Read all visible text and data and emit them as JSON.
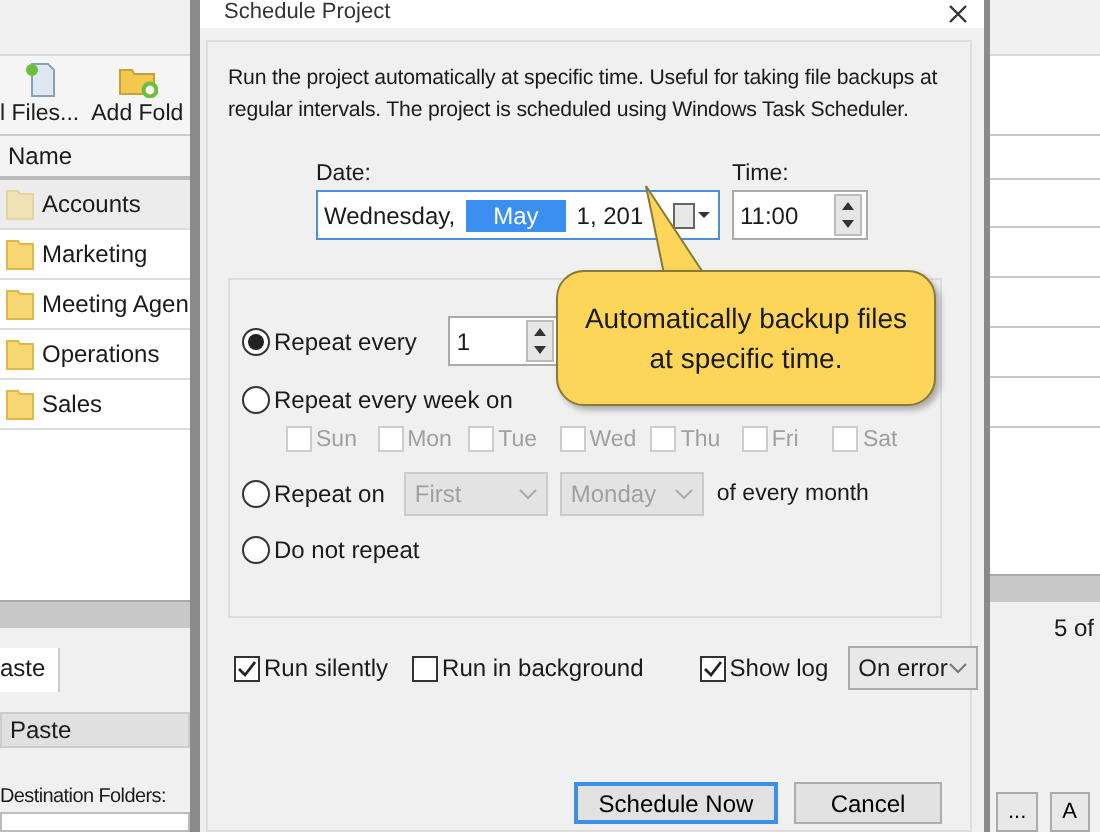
{
  "background_app": {
    "toolbar": [
      {
        "label": "l Files..."
      },
      {
        "label": "Add Fold"
      }
    ],
    "table": {
      "columns": [
        "Name"
      ],
      "rows": [
        {
          "name": "Accounts",
          "selected": true
        },
        {
          "name": "Marketing",
          "selected": false
        },
        {
          "name": "Meeting Agen",
          "selected": false
        },
        {
          "name": "Operations",
          "selected": false
        },
        {
          "name": "Sales",
          "selected": false
        }
      ]
    },
    "tab": {
      "label": "aste"
    },
    "paste_field": {
      "value": "Paste"
    },
    "destination_label": "Destination Folders:",
    "count": "5 of",
    "buttons": [
      "...",
      "A"
    ]
  },
  "dialog": {
    "title": "Schedule Project",
    "description": "Run the project automatically at specific time. Useful for taking file backups at regular intervals. The project is scheduled using Windows Task Scheduler.",
    "date": {
      "label": "Date:",
      "weekday": "Wednesday,",
      "month": "May",
      "rest": "1, 201"
    },
    "time": {
      "label": "Time:",
      "value": "11:00"
    },
    "repeat_options": [
      {
        "kind": "interval",
        "label": "Repeat every",
        "selected": true,
        "value": "1"
      },
      {
        "kind": "weekly",
        "label": "Repeat every week on",
        "selected": false,
        "days": [
          {
            "label": "Sun",
            "checked": false,
            "disabled": true
          },
          {
            "label": "Mon",
            "checked": false,
            "disabled": true
          },
          {
            "label": "Tue",
            "checked": false,
            "disabled": true
          },
          {
            "label": "Wed",
            "checked": false,
            "disabled": true
          },
          {
            "label": "Thu",
            "checked": false,
            "disabled": true
          },
          {
            "label": "Fri",
            "checked": false,
            "disabled": true
          },
          {
            "label": "Sat",
            "checked": false,
            "disabled": true
          }
        ]
      },
      {
        "kind": "monthly",
        "label": "Repeat on",
        "selected": false,
        "ordinal": "First",
        "weekday": "Monday",
        "suffix": "of every month",
        "disabled": true
      },
      {
        "kind": "none",
        "label": "Do not repeat",
        "selected": false
      }
    ],
    "options": [
      {
        "label": "Run silently",
        "checked": true
      },
      {
        "label": "Run in background",
        "checked": false
      },
      {
        "label": "Show log",
        "checked": true
      }
    ],
    "log_select": {
      "value": "On error"
    },
    "buttons": [
      {
        "label": "Schedule Now",
        "default": true
      },
      {
        "label": "Cancel",
        "default": false
      }
    ]
  },
  "callout": {
    "text": "Automatically backup files at specific time."
  }
}
